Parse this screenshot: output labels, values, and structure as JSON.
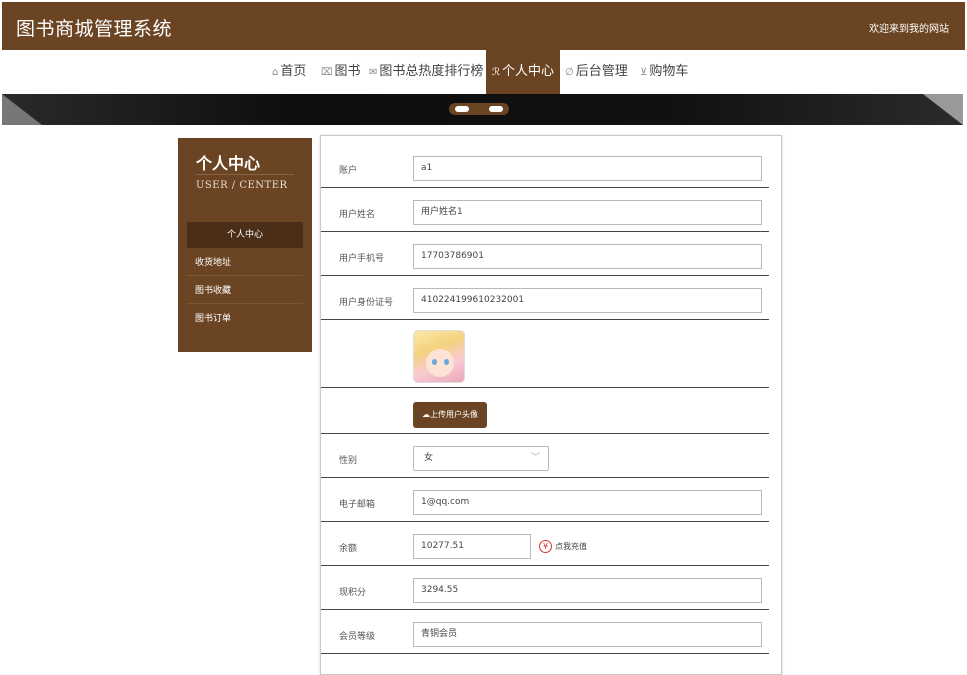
{
  "header": {
    "title": "图书商城管理系统",
    "welcome": "欢迎来到我的网站"
  },
  "nav": [
    {
      "icon": "home-icon",
      "glyph": "⌂",
      "label": "首页"
    },
    {
      "icon": "book-icon",
      "glyph": "⌧",
      "label": "图书"
    },
    {
      "icon": "list-icon",
      "glyph": "✉",
      "label": "图书总热度排行榜"
    },
    {
      "icon": "user-icon",
      "glyph": "ℛ",
      "label": "个人中心"
    },
    {
      "icon": "link-icon",
      "glyph": "∅",
      "label": "后台管理"
    },
    {
      "icon": "cart-icon",
      "glyph": "⊻",
      "label": "购物车"
    }
  ],
  "sidebar": {
    "title": "个人中心",
    "subtitle": "USER / CENTER",
    "items": [
      {
        "label": "个人中心"
      },
      {
        "label": "收货地址"
      },
      {
        "label": "图书收藏"
      },
      {
        "label": "图书订单"
      }
    ]
  },
  "form": {
    "account_label": "账户",
    "account_value": "a1",
    "name_label": "用户姓名",
    "name_value": "用户姓名1",
    "phone_label": "用户手机号",
    "phone_value": "17703786901",
    "idcard_label": "用户身份证号",
    "idcard_value": "410224199610232001",
    "upload_label": "上传用户头像",
    "gender_label": "性别",
    "gender_value": "女",
    "email_label": "电子邮箱",
    "email_value": "1@qq.com",
    "balance_label": "余额",
    "balance_value": "10277.51",
    "recharge_label": "点我充值",
    "points_label": "现积分",
    "points_value": "3294.55",
    "level_label": "会员等级",
    "level_value": "青铜会员"
  },
  "colors": {
    "brand": "#6b4423",
    "recharge": "#dd3333"
  }
}
